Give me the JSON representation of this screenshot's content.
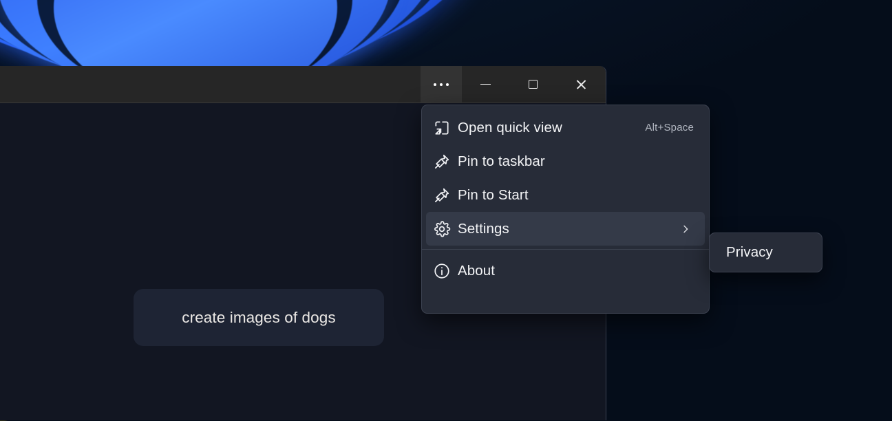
{
  "desktop": {
    "wallpaper_name": "windows-bloom-wallpaper",
    "background_color": "#050d1a",
    "photo_thumbnail_name": "dog-photo-thumbnail"
  },
  "window": {
    "titlebar_color": "#262626",
    "body_color": "#121622",
    "caption_buttons": [
      {
        "name": "more-options-button",
        "icon": "ellipsis-icon",
        "label": "",
        "active": true
      },
      {
        "name": "minimize-button",
        "icon": "minimize-icon",
        "label": ""
      },
      {
        "name": "maximize-button",
        "icon": "maximize-icon",
        "label": ""
      },
      {
        "name": "close-button",
        "icon": "close-icon",
        "label": ""
      }
    ],
    "prompt_chip": {
      "text": "create images of dogs",
      "background": "#1e2434"
    }
  },
  "context_menu": {
    "background": "#272c38",
    "highlight_color": "#343a48",
    "items": [
      {
        "label": "Open quick view",
        "icon": "quick-view-icon",
        "accelerator": "Alt+Space",
        "selected": false,
        "has_submenu": false
      },
      {
        "label": "Pin to taskbar",
        "icon": "pin-icon",
        "accelerator": "",
        "selected": false,
        "has_submenu": false
      },
      {
        "label": "Pin to Start",
        "icon": "pin-icon",
        "accelerator": "",
        "selected": false,
        "has_submenu": false
      },
      {
        "label": "Settings",
        "icon": "gear-icon",
        "accelerator": "",
        "selected": true,
        "has_submenu": true
      },
      {
        "label": "About",
        "icon": "info-icon",
        "accelerator": "",
        "selected": false,
        "has_submenu": false
      }
    ]
  },
  "submenu": {
    "background": "#272c38",
    "items": [
      {
        "label": "Privacy"
      }
    ]
  }
}
